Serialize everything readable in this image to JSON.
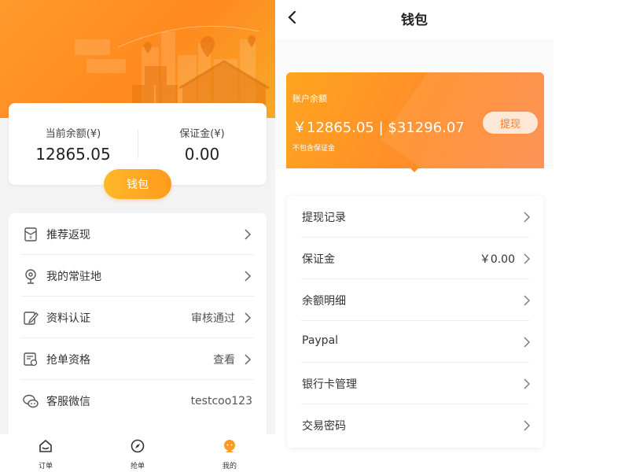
{
  "left": {
    "balance": {
      "current_label": "当前余额(¥)",
      "current_value": "12865.05",
      "deposit_label": "保证金(¥)",
      "deposit_value": "0.00"
    },
    "wallet_button": "钱包",
    "menu": [
      {
        "label": "推荐返现",
        "value": "",
        "icon": "gift-envelope-icon",
        "arrow": true
      },
      {
        "label": "我的常驻地",
        "value": "",
        "icon": "location-pin-icon",
        "arrow": true
      },
      {
        "label": "资料认证",
        "value": "审核通过",
        "icon": "edit-document-icon",
        "arrow": true
      },
      {
        "label": "抢单资格",
        "value": "查看",
        "icon": "certificate-icon",
        "arrow": true
      },
      {
        "label": "客服微信",
        "value": "testcoo123",
        "icon": "wechat-icon",
        "arrow": false
      }
    ],
    "tabs": [
      {
        "label": "订单",
        "icon": "inbox-icon"
      },
      {
        "label": "抢单",
        "icon": "compass-icon"
      },
      {
        "label": "我的",
        "icon": "avatar-icon"
      }
    ],
    "colors": {
      "accent": "#ff9a24",
      "accent_light": "#ffb829"
    }
  },
  "right": {
    "title": "钱包",
    "account": {
      "label": "账户余额",
      "amount": "￥12865.05 | $31296.07",
      "note": "不包含保证金",
      "withdraw_button": "提现"
    },
    "list": [
      {
        "label": "提现记录",
        "value": ""
      },
      {
        "label": "保证金",
        "value": "￥0.00"
      },
      {
        "label": "余额明细",
        "value": ""
      },
      {
        "label": "Paypal",
        "value": ""
      },
      {
        "label": "银行卡管理",
        "value": ""
      },
      {
        "label": "交易密码",
        "value": ""
      }
    ]
  }
}
